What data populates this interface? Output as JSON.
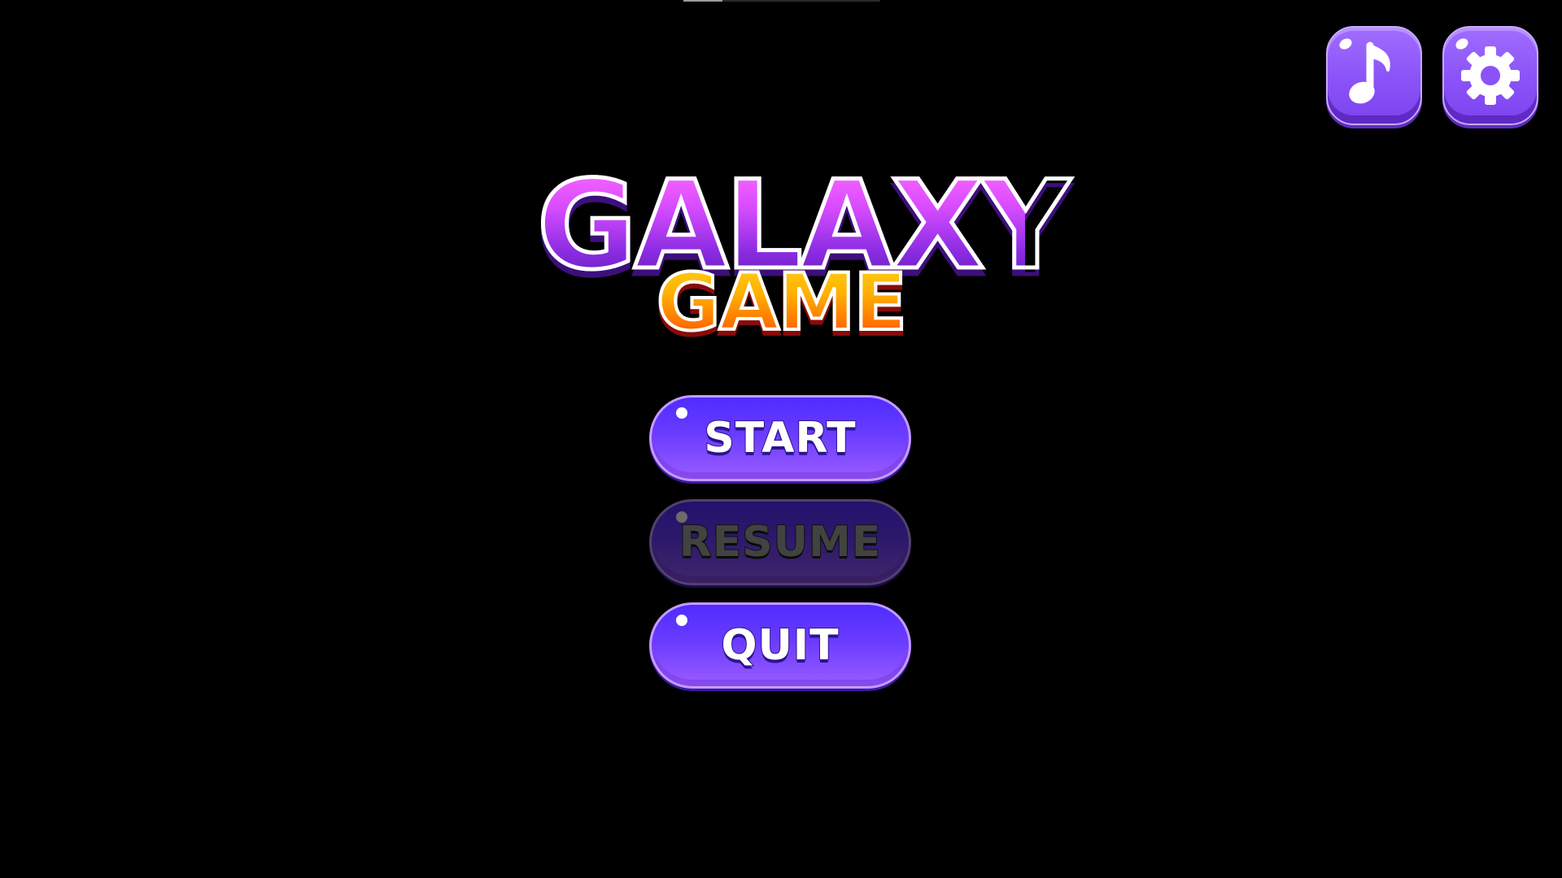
{
  "logo": {
    "title": "GALAXY",
    "subtitle": "GAME"
  },
  "menu": {
    "start_label": "START",
    "resume_label": "RESUME",
    "resume_state": "disabled",
    "quit_label": "QUIT"
  },
  "toolbar": {
    "music_icon": "music-note-icon",
    "settings_icon": "gear-icon"
  },
  "colors": {
    "background": "#000000",
    "button_top": "#4f2cff",
    "button_bottom": "#9a5cff",
    "button_border": "#c59bff",
    "title_purple": "#b23cff",
    "subtitle_orange": "#ff8c00"
  }
}
